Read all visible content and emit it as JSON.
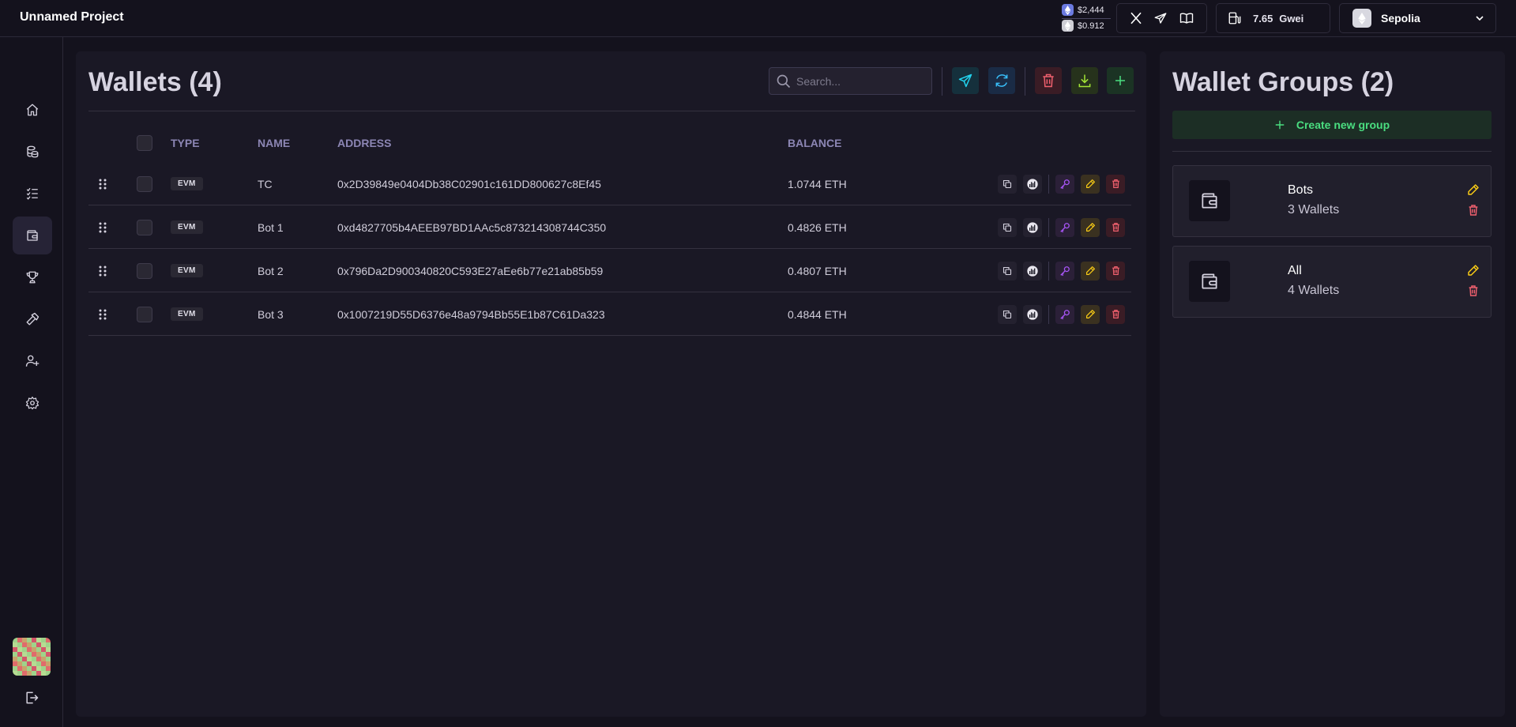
{
  "app": {
    "project_name": "Unnamed Project"
  },
  "header": {
    "prices": [
      {
        "icon": "ethereum-icon",
        "value": "$2,444"
      },
      {
        "icon": "token-icon",
        "value": "$0.912"
      }
    ],
    "social": [
      "x-icon",
      "telegram-icon",
      "docs-book-icon"
    ],
    "gas": {
      "icon": "gas-pump-icon",
      "value": "7.65",
      "unit": "Gwei"
    },
    "network": {
      "name": "Sepolia",
      "icon": "ethereum-icon"
    }
  },
  "sidebar": {
    "items": [
      {
        "name": "home",
        "icon": "home-icon",
        "active": false
      },
      {
        "name": "coins",
        "icon": "coins-icon",
        "active": false
      },
      {
        "name": "tasks",
        "icon": "list-check-icon",
        "active": false
      },
      {
        "name": "wallets",
        "icon": "wallet-icon",
        "active": true
      },
      {
        "name": "rewards",
        "icon": "trophy-icon",
        "active": false
      },
      {
        "name": "tools",
        "icon": "hammer-icon",
        "active": false
      },
      {
        "name": "users",
        "icon": "user-plus-icon",
        "active": false
      },
      {
        "name": "settings",
        "icon": "gear-icon",
        "active": false
      }
    ],
    "logout_icon": "logout-icon"
  },
  "wallets": {
    "title": "Wallets (4)",
    "search_placeholder": "Search...",
    "columns": {
      "type": "TYPE",
      "name": "NAME",
      "address": "ADDRESS",
      "balance": "BALANCE"
    },
    "rows": [
      {
        "type": "EVM",
        "name": "TC",
        "address": "0x2D39849e0404Db38C02901c161DD800627c8Ef45",
        "balance": "1.0744 ETH"
      },
      {
        "type": "EVM",
        "name": "Bot 1",
        "address": "0xd4827705b4AEEB97BD1AAc5c873214308744C350",
        "balance": "0.4826 ETH"
      },
      {
        "type": "EVM",
        "name": "Bot 2",
        "address": "0x796Da2D900340820C593E27aEe6b77e21ab85b59",
        "balance": "0.4807 ETH"
      },
      {
        "type": "EVM",
        "name": "Bot 3",
        "address": "0x1007219D55D6376e48a9794Bb55E1b87C61Da323",
        "balance": "0.4844 ETH"
      }
    ]
  },
  "groups": {
    "title": "Wallet Groups (2)",
    "create_label": "Create new group",
    "items": [
      {
        "name": "Bots",
        "count": "3 Wallets"
      },
      {
        "name": "All",
        "count": "4 Wallets"
      }
    ]
  },
  "colors": {
    "background": "#14121d",
    "panel": "#1a1825",
    "header_accent": "#8c86b4",
    "green": "#4ade80",
    "red": "#f0606e",
    "yellow": "#facc15",
    "purple": "#a855f7",
    "cyan": "#22d3ee"
  }
}
